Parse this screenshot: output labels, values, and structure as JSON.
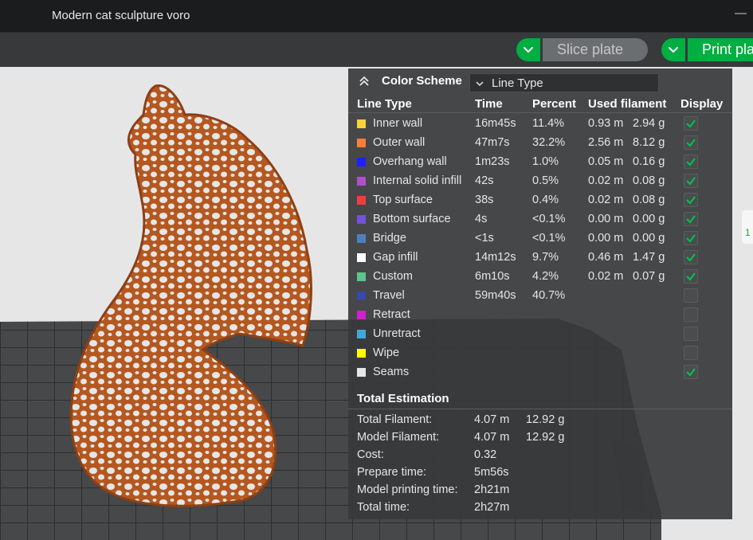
{
  "window": {
    "title": "Modern cat sculpture voro",
    "minimize": "—"
  },
  "toolbar": {
    "slice_label": "Slice plate",
    "print_label": "Print plate"
  },
  "side_tab_label": "1",
  "legend": {
    "title": "Color Scheme",
    "scheme_value": "Line Type",
    "columns": {
      "type": "Line Type",
      "time": "Time",
      "percent": "Percent",
      "used": "Used filament",
      "display": "Display"
    },
    "rows": [
      {
        "name": "Inner wall",
        "color": "#f5d33b",
        "time": "16m45s",
        "percent": "11.4%",
        "len": "0.93 m",
        "weight": "2.94 g",
        "checked": true
      },
      {
        "name": "Outer wall",
        "color": "#ff7d38",
        "time": "47m7s",
        "percent": "32.2%",
        "len": "2.56 m",
        "weight": "8.12 g",
        "checked": true
      },
      {
        "name": "Overhang wall",
        "color": "#1f1fff",
        "time": "1m23s",
        "percent": "1.0%",
        "len": "0.05 m",
        "weight": "0.16 g",
        "checked": true
      },
      {
        "name": "Internal solid infill",
        "color": "#b050c8",
        "time": "42s",
        "percent": "0.5%",
        "len": "0.02 m",
        "weight": "0.08 g",
        "checked": true
      },
      {
        "name": "Top surface",
        "color": "#f03e3e",
        "time": "38s",
        "percent": "0.4%",
        "len": "0.02 m",
        "weight": "0.08 g",
        "checked": true
      },
      {
        "name": "Bottom surface",
        "color": "#7252d8",
        "time": "4s",
        "percent": "<0.1%",
        "len": "0.00 m",
        "weight": "0.00 g",
        "checked": true
      },
      {
        "name": "Bridge",
        "color": "#4d80ba",
        "time": "<1s",
        "percent": "<0.1%",
        "len": "0.00 m",
        "weight": "0.00 g",
        "checked": true
      },
      {
        "name": "Gap infill",
        "color": "#ffffff",
        "time": "14m12s",
        "percent": "9.7%",
        "len": "0.46 m",
        "weight": "1.47 g",
        "checked": true
      },
      {
        "name": "Custom",
        "color": "#5dc58c",
        "time": "6m10s",
        "percent": "4.2%",
        "len": "0.02 m",
        "weight": "0.07 g",
        "checked": true
      },
      {
        "name": "Travel",
        "color": "#3848a8",
        "time": "59m40s",
        "percent": "40.7%",
        "len": "",
        "weight": "",
        "checked": false
      },
      {
        "name": "Retract",
        "color": "#d020d0",
        "time": "",
        "percent": "",
        "len": "",
        "weight": "",
        "checked": false
      },
      {
        "name": "Unretract",
        "color": "#40a8d8",
        "time": "",
        "percent": "",
        "len": "",
        "weight": "",
        "checked": false
      },
      {
        "name": "Wipe",
        "color": "#ffff00",
        "time": "",
        "percent": "",
        "len": "",
        "weight": "",
        "checked": false
      },
      {
        "name": "Seams",
        "color": "#e6e6e6",
        "time": "",
        "percent": "",
        "len": "",
        "weight": "",
        "checked": true
      }
    ],
    "total_title": "Total Estimation",
    "totals": [
      {
        "label": "Total Filament:",
        "v1": "4.07 m",
        "v2": "12.92 g"
      },
      {
        "label": "Model Filament:",
        "v1": "4.07 m",
        "v2": "12.92 g"
      },
      {
        "label": "Cost:",
        "v1": "0.32",
        "v2": ""
      },
      {
        "label": "Prepare time:",
        "v1": "5m56s",
        "v2": ""
      },
      {
        "label": "Model printing time:",
        "v1": "2h21m",
        "v2": ""
      },
      {
        "label": "Total time:",
        "v1": "2h27m",
        "v2": ""
      }
    ]
  },
  "colors": {
    "accent": "#00ae42",
    "panel": "#383a3c",
    "cat": "#b5581f"
  }
}
